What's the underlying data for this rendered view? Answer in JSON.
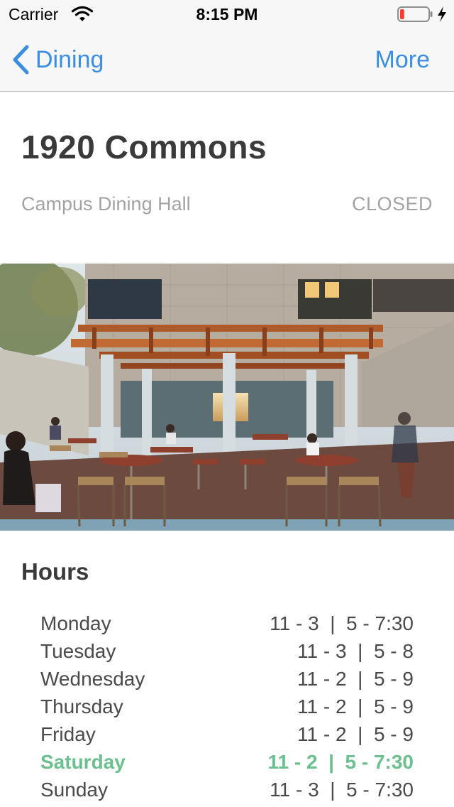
{
  "status_bar": {
    "carrier": "Carrier",
    "time": "8:15 PM",
    "battery_level": 0.1
  },
  "nav": {
    "back_label": "Dining",
    "more_label": "More",
    "tint_color": "#3b8ee0"
  },
  "venue": {
    "name": "1920 Commons",
    "type": "Campus Dining Hall",
    "status": "CLOSED"
  },
  "hours": {
    "heading": "Hours",
    "highlight_color": "#6cbf8f",
    "days": [
      {
        "day": "Monday",
        "time": "11 - 3  |  5 - 7:30",
        "today": false
      },
      {
        "day": "Tuesday",
        "time": "11 - 3  |  5 - 8",
        "today": false
      },
      {
        "day": "Wednesday",
        "time": "11 - 2  |  5 - 9",
        "today": false
      },
      {
        "day": "Thursday",
        "time": "11 - 2  |  5 - 9",
        "today": false
      },
      {
        "day": "Friday",
        "time": "11 - 2  |  5 - 9",
        "today": false
      },
      {
        "day": "Saturday",
        "time": "11 - 2  |  5 - 7:30",
        "today": true
      },
      {
        "day": "Sunday",
        "time": "11 - 3  |  5 - 7:30",
        "today": false
      }
    ]
  },
  "icons": {
    "wifi": "wifi-icon",
    "battery": "battery-icon",
    "charging": "charging-bolt-icon",
    "back": "chevron-left-icon"
  }
}
